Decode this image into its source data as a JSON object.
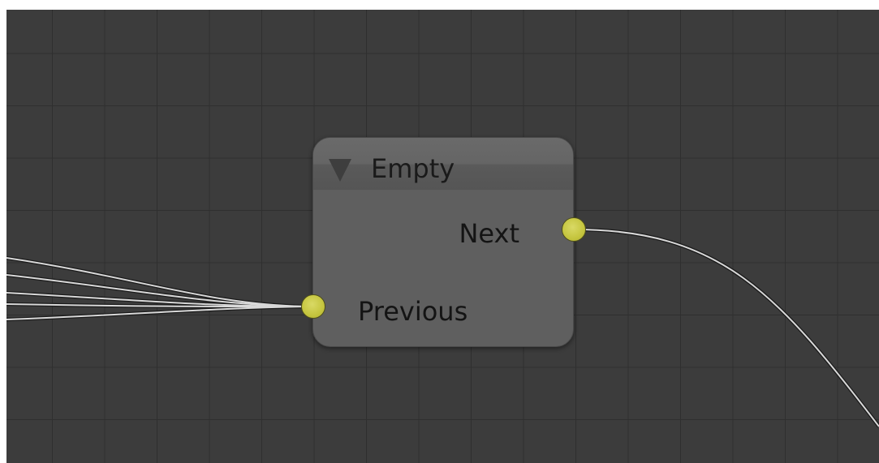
{
  "editor": {
    "background_color": "#3c3c3c",
    "grid_color": "#2f2f2f",
    "link_color": "#d8d8d8"
  },
  "node": {
    "title": "Empty",
    "collapse_icon": "triangle-down-icon",
    "outputs": [
      {
        "label": "Next",
        "socket_color": "#c5c53e"
      }
    ],
    "inputs": [
      {
        "label": "Previous",
        "socket_color": "#c5c53e"
      }
    ]
  },
  "links": {
    "incoming_count": 5,
    "outgoing_count": 1
  }
}
